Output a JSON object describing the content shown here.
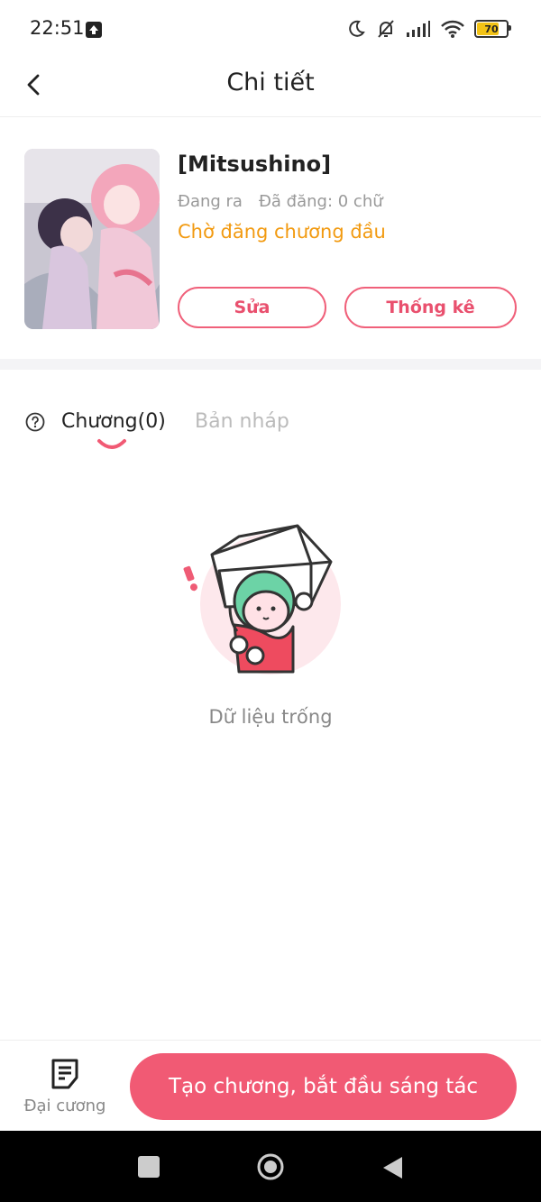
{
  "status_bar": {
    "time": "22:51",
    "battery": "70",
    "battery_level": 0.7,
    "icons": [
      "upload-icon",
      "moon-icon",
      "bell-off-icon",
      "signal-icon",
      "wifi-icon",
      "battery-icon"
    ]
  },
  "header": {
    "title": "Chi tiết",
    "back_icon": "chevron-left-icon"
  },
  "work": {
    "title": "[Mitsushino]",
    "state": "Đang ra",
    "posted": "Đã đăng: 0 chữ",
    "status": "Chờ đăng chương đầu",
    "edit_label": "Sửa",
    "stats_label": "Thống kê"
  },
  "tabs": {
    "chapters": "Chương(0)",
    "drafts": "Bản nháp",
    "active": "chapters"
  },
  "empty": {
    "text": "Dữ liệu trống"
  },
  "bottom": {
    "outline_label": "Đại cương",
    "create_label": "Tạo chương, bắt đầu sáng tác"
  },
  "colors": {
    "accent": "#f15a74",
    "status_orange": "#f29a10",
    "muted": "#999999"
  }
}
